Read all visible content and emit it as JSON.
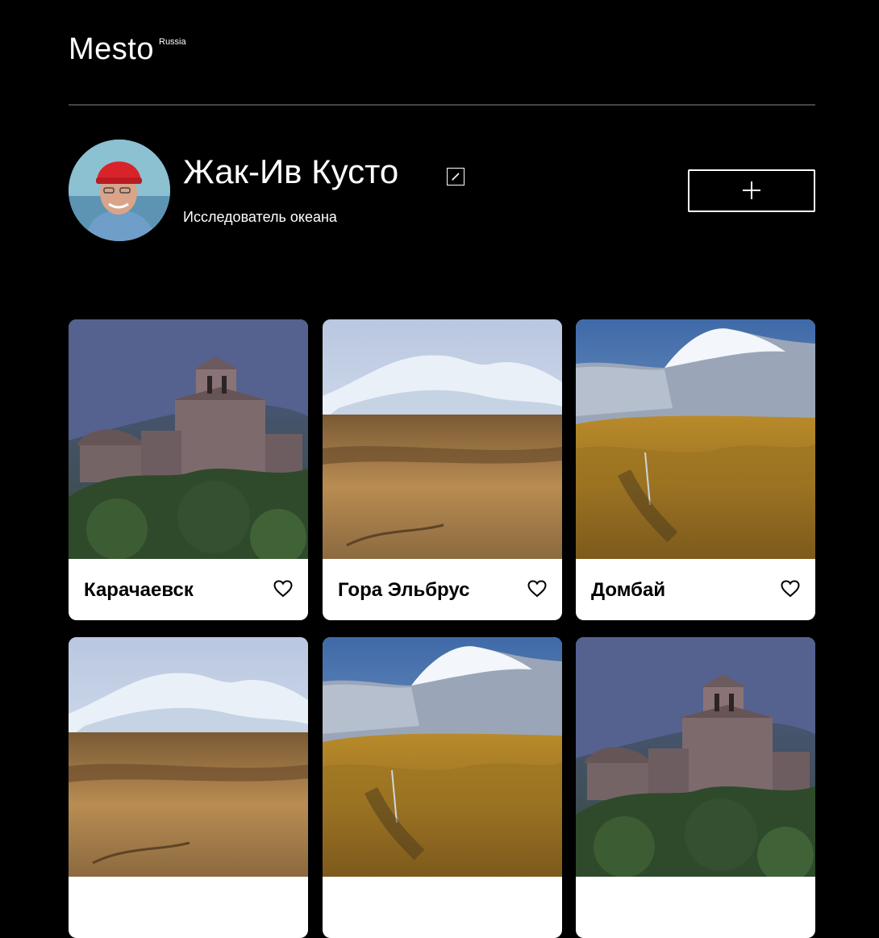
{
  "header": {
    "logo": "Mesto",
    "logo_sup": "Russia"
  },
  "profile": {
    "name": "Жак-Ив Кусто",
    "about": "Исследователь океана"
  },
  "colors": {
    "background": "#000000",
    "card": "#ffffff",
    "divider": "#454545"
  },
  "cards": [
    {
      "title": "Карачаевск",
      "photo": "church-ruins"
    },
    {
      "title": "Гора Эльбрус",
      "photo": "snow-mountain-steppe"
    },
    {
      "title": "Домбай",
      "photo": "mountain-autumn-forest"
    },
    {
      "title": "",
      "photo": "snow-mountain-steppe"
    },
    {
      "title": "",
      "photo": "mountain-autumn-forest"
    },
    {
      "title": "",
      "photo": "church-ruins"
    }
  ]
}
